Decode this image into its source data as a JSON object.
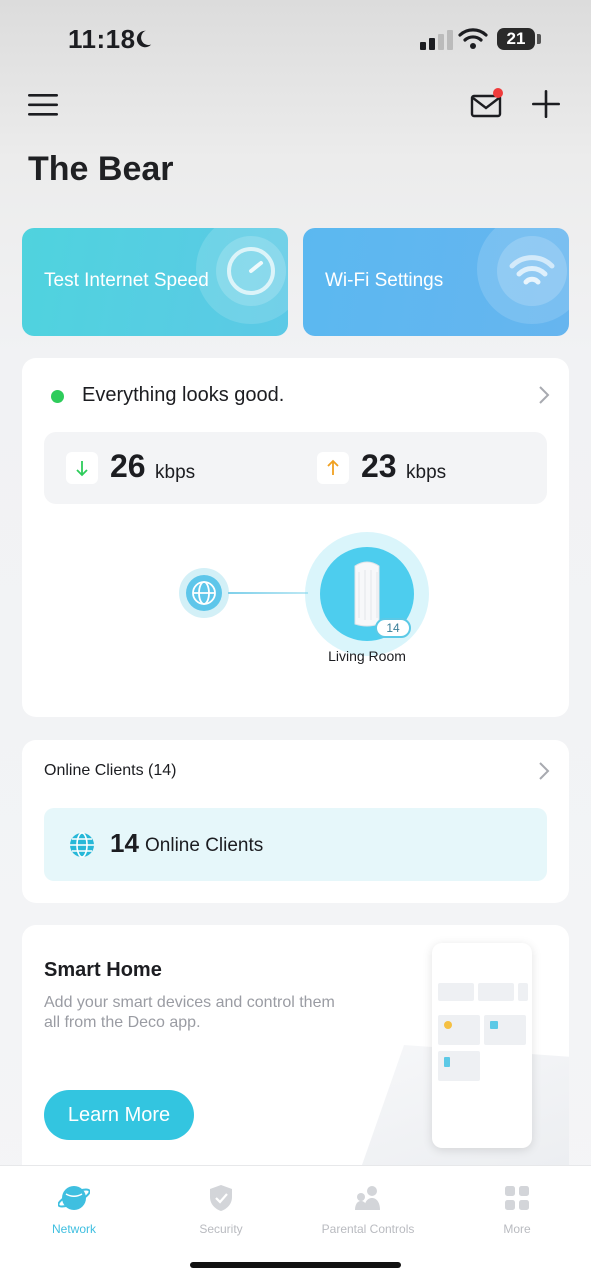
{
  "status_bar": {
    "time": "11:18",
    "battery": "21"
  },
  "header": {
    "title": "The Bear"
  },
  "quick_actions": [
    {
      "label": "Test Internet Speed",
      "icon": "speedometer-icon"
    },
    {
      "label": "Wi-Fi Settings",
      "icon": "wifi-icon"
    }
  ],
  "network_status": {
    "message": "Everything looks good.",
    "status_color": "#2ecc5b",
    "download": {
      "value": "26",
      "unit": "kbps"
    },
    "upload": {
      "value": "23",
      "unit": "kbps"
    },
    "node": {
      "name": "Living Room",
      "clients": "14"
    }
  },
  "online_clients": {
    "title": "Online Clients (14)",
    "count": "14",
    "label": "Online Clients"
  },
  "smart_home": {
    "title": "Smart Home",
    "description": "Add your smart devices and control them all from the Deco app.",
    "button": "Learn More"
  },
  "tab_bar": {
    "tabs": [
      {
        "label": "Network",
        "icon": "network-globe-icon",
        "active": true
      },
      {
        "label": "Security",
        "icon": "shield-icon",
        "active": false
      },
      {
        "label": "Parental Controls",
        "icon": "family-icon",
        "active": false
      },
      {
        "label": "More",
        "icon": "grid-icon",
        "active": false
      }
    ]
  },
  "colors": {
    "accent": "#33c5e0",
    "tile_speed": "#4fd3de",
    "tile_wifi": "#5bb8f0"
  }
}
